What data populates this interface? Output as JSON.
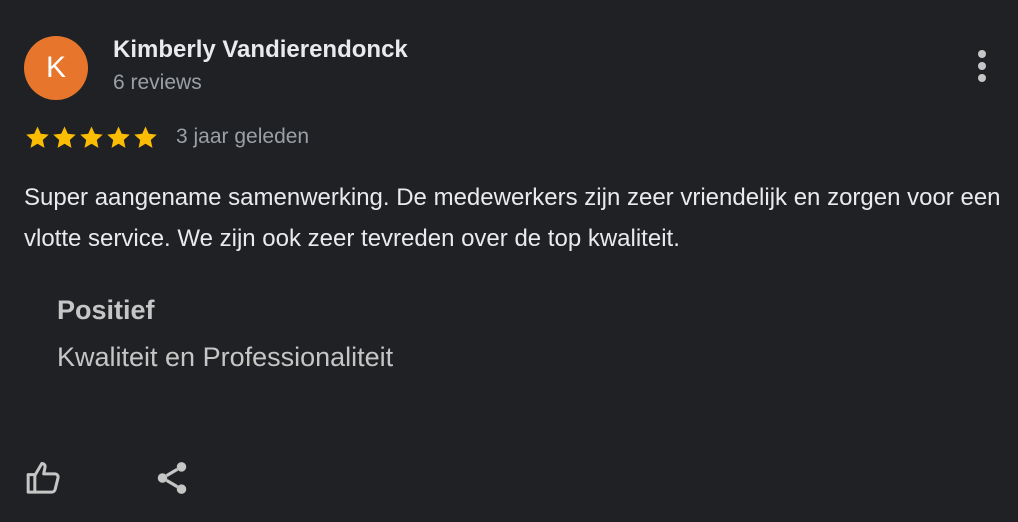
{
  "review": {
    "avatar_letter": "K",
    "avatar_color": "#e8752c",
    "author_name": "Kimberly Vandierendonck",
    "review_count": "6 reviews",
    "rating": 5,
    "rating_max": 5,
    "star_color": "#fbbc04",
    "time": "3 jaar geleden",
    "text": "Super aangename samenwerking. De medewerkers zijn zeer vriendelijk en zorgen voor een vlotte service. We zijn ook zeer tevreden over de top kwaliteit.",
    "attribute": {
      "label": "Positief",
      "value": "Kwaliteit en Professionaliteit"
    }
  },
  "icons": {
    "more": "more-vert-icon",
    "like": "thumb-up-icon",
    "share": "share-icon",
    "star": "star-icon"
  }
}
